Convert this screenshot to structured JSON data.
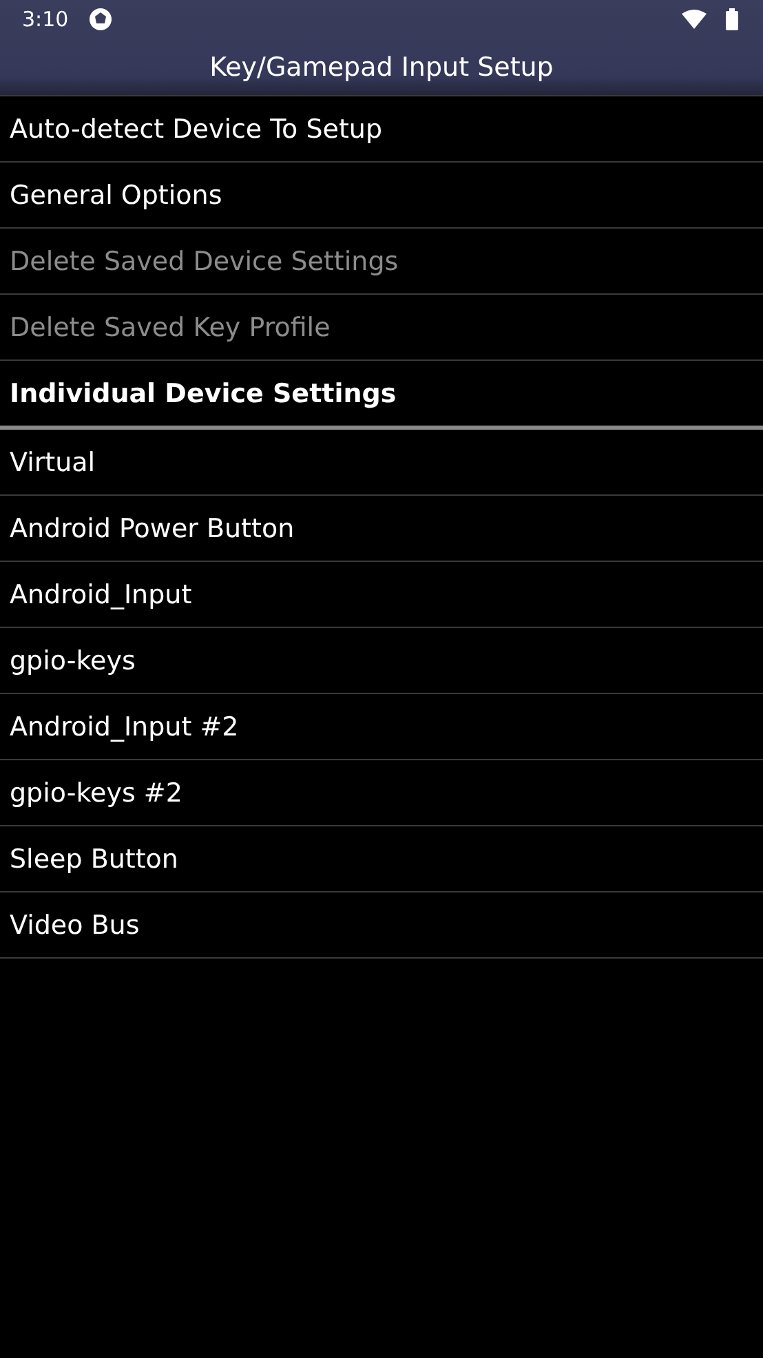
{
  "status_bar": {
    "time": "3:10"
  },
  "title": "Key/Gamepad Input Setup",
  "items": [
    {
      "kind": "item",
      "label": "Auto-detect Device To Setup",
      "disabled": false
    },
    {
      "kind": "item",
      "label": "General Options",
      "disabled": false
    },
    {
      "kind": "item",
      "label": "Delete Saved Device Settings",
      "disabled": true
    },
    {
      "kind": "item",
      "label": "Delete Saved Key Profile",
      "disabled": true
    },
    {
      "kind": "header",
      "label": "Individual Device Settings"
    },
    {
      "kind": "item",
      "label": "Virtual",
      "disabled": false
    },
    {
      "kind": "item",
      "label": "Android Power Button",
      "disabled": false
    },
    {
      "kind": "item",
      "label": "Android_Input",
      "disabled": false
    },
    {
      "kind": "item",
      "label": "gpio-keys",
      "disabled": false
    },
    {
      "kind": "item",
      "label": "Android_Input #2",
      "disabled": false
    },
    {
      "kind": "item",
      "label": "gpio-keys #2",
      "disabled": false
    },
    {
      "kind": "item",
      "label": "Sleep Button",
      "disabled": false
    },
    {
      "kind": "item",
      "label": "Video Bus",
      "disabled": false
    }
  ]
}
